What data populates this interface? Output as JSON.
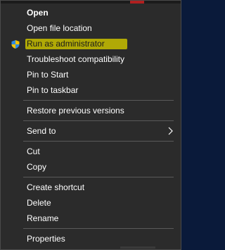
{
  "menu": {
    "items": [
      {
        "label": "Open"
      },
      {
        "label": "Open file location"
      },
      {
        "label": "Run as administrator",
        "icon": "shield-icon"
      },
      {
        "label": "Troubleshoot compatibility"
      },
      {
        "label": "Pin to Start"
      },
      {
        "label": "Pin to taskbar"
      },
      {
        "label": "Restore previous versions"
      },
      {
        "label": "Send to",
        "icon": "chevron-right-icon"
      },
      {
        "label": "Cut"
      },
      {
        "label": "Copy"
      },
      {
        "label": "Create shortcut"
      },
      {
        "label": "Delete"
      },
      {
        "label": "Rename"
      },
      {
        "label": "Properties"
      }
    ]
  },
  "colors": {
    "background": "#2b2b2b",
    "text": "#ffffff",
    "separator": "#5a5a5a",
    "highlight": "#c8c000",
    "shield_blue": "#2f8ae0",
    "shield_yellow": "#f2c200"
  }
}
